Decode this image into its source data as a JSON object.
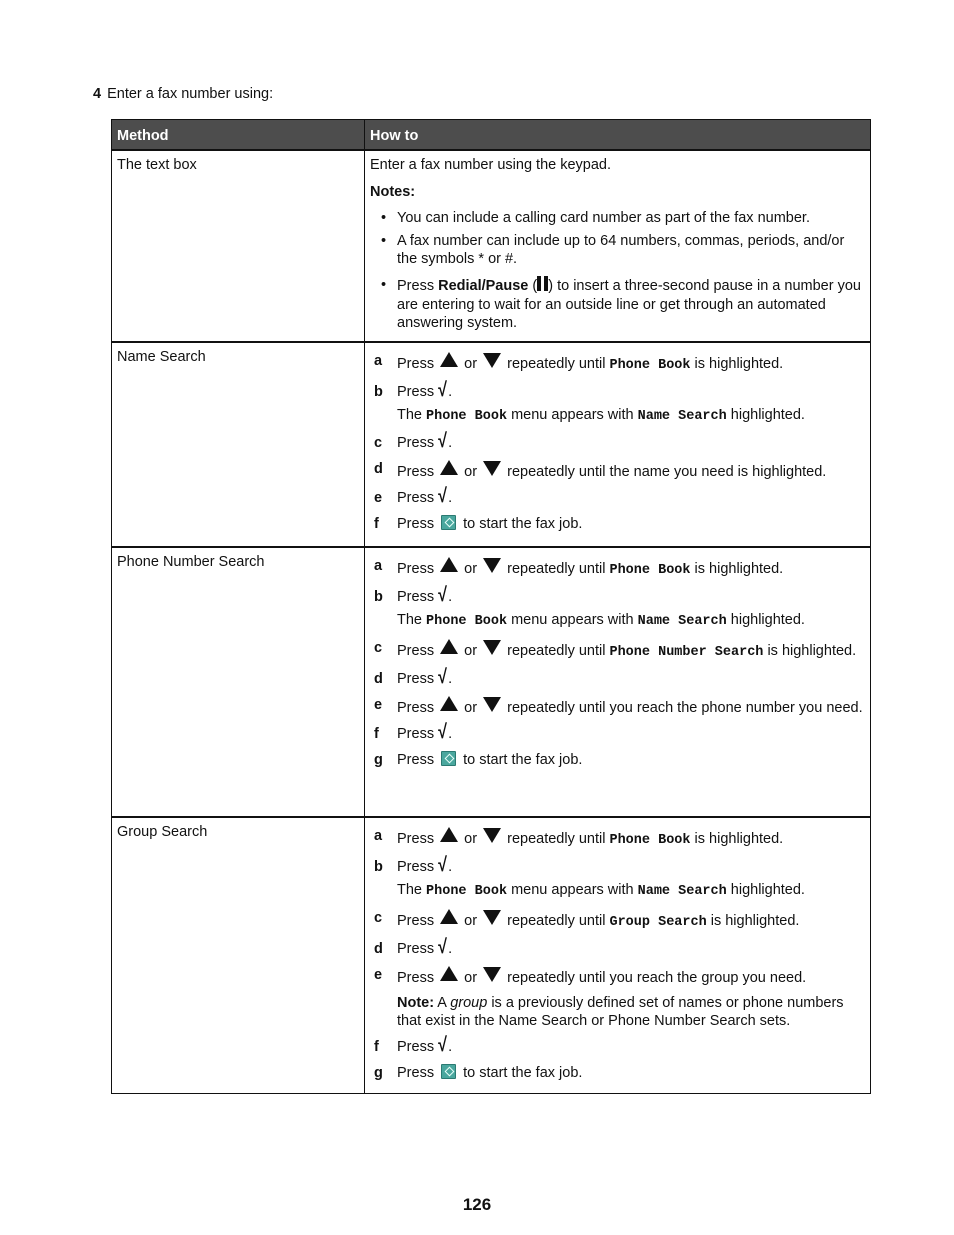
{
  "step": {
    "number": "4",
    "text": "Enter a fax number using:"
  },
  "table": {
    "headers": {
      "method": "Method",
      "howto": "How to"
    },
    "rows": [
      {
        "method": "The text box",
        "intro": "Enter a fax number using the keypad.",
        "notes_label": "Notes:",
        "notes": [
          "You can include a calling card number as part of the fax number.",
          "A fax number can include up to 64 numbers, commas, periods, and/or the symbols * or #."
        ],
        "pause_note": {
          "prefix": "Press ",
          "button": "Redial/Pause",
          "open": " (",
          "close": ") to insert a three-second pause in a number you are entering to wait for an outside line or get through an automated answering system."
        }
      },
      {
        "method": "Name Search",
        "steps": {
          "a": {
            "letter": "a",
            "press": "Press",
            "or": "or",
            "before": "repeatedly until",
            "mono": "Phone Book",
            "after": "is highlighted."
          },
          "b": {
            "letter": "b",
            "press": "Press",
            "period": ".",
            "sub_pre": "The",
            "sub_mono1": "Phone Book",
            "sub_mid": "menu appears with",
            "sub_mono2": "Name Search",
            "sub_post": "highlighted."
          },
          "c": {
            "letter": "c",
            "press": "Press",
            "period": "."
          },
          "d": {
            "letter": "d",
            "press": "Press",
            "or": "or",
            "text": "repeatedly until the name you need is highlighted."
          },
          "e": {
            "letter": "e",
            "press": "Press",
            "period": "."
          },
          "f": {
            "letter": "f",
            "press": "Press",
            "text": "to start the fax job."
          }
        }
      },
      {
        "method": "Phone Number Search",
        "steps": {
          "a": {
            "letter": "a",
            "press": "Press",
            "or": "or",
            "before": "repeatedly until",
            "mono": "Phone Book",
            "after": "is highlighted."
          },
          "b": {
            "letter": "b",
            "press": "Press",
            "period": ".",
            "sub_pre": "The",
            "sub_mono1": "Phone Book",
            "sub_mid": "menu appears with",
            "sub_mono2": "Name Search",
            "sub_post": "highlighted."
          },
          "c": {
            "letter": "c",
            "press": "Press",
            "or": "or",
            "before": "repeatedly until",
            "mono": "Phone Number Search",
            "after": "is highlighted."
          },
          "d": {
            "letter": "d",
            "press": "Press",
            "period": "."
          },
          "e": {
            "letter": "e",
            "press": "Press",
            "or": "or",
            "text": "repeatedly until you reach the phone number you need."
          },
          "f": {
            "letter": "f",
            "press": "Press",
            "period": "."
          },
          "g": {
            "letter": "g",
            "press": "Press",
            "text": "to start the fax job."
          }
        }
      },
      {
        "method": "Group Search",
        "steps": {
          "a": {
            "letter": "a",
            "press": "Press",
            "or": "or",
            "before": "repeatedly until",
            "mono": "Phone Book",
            "after": "is highlighted."
          },
          "b": {
            "letter": "b",
            "press": "Press",
            "period": ".",
            "sub_pre": "The",
            "sub_mono1": "Phone Book",
            "sub_mid": "menu appears with",
            "sub_mono2": "Name Search",
            "sub_post": "highlighted."
          },
          "c": {
            "letter": "c",
            "press": "Press",
            "or": "or",
            "before": "repeatedly until",
            "mono": "Group Search",
            "after": "is highlighted."
          },
          "d": {
            "letter": "d",
            "press": "Press",
            "period": "."
          },
          "e": {
            "letter": "e",
            "press": "Press",
            "or": "or",
            "text": "repeatedly until you reach the group you need.",
            "note_label": "Note:",
            "note_pre": "A",
            "note_italic": "group",
            "note_post": "is a previously defined set of names or phone numbers that exist in the Name Search or Phone Number Search sets."
          },
          "f": {
            "letter": "f",
            "press": "Press",
            "period": "."
          },
          "g": {
            "letter": "g",
            "press": "Press",
            "text": "to start the fax job."
          }
        }
      }
    ]
  },
  "icons": {
    "up": "up-arrow-icon",
    "down": "down-arrow-icon",
    "select": "checkmark-icon",
    "start": "start-icon",
    "pause": "pause-icon",
    "start_color": "#4aa79e"
  },
  "page_number": "126"
}
